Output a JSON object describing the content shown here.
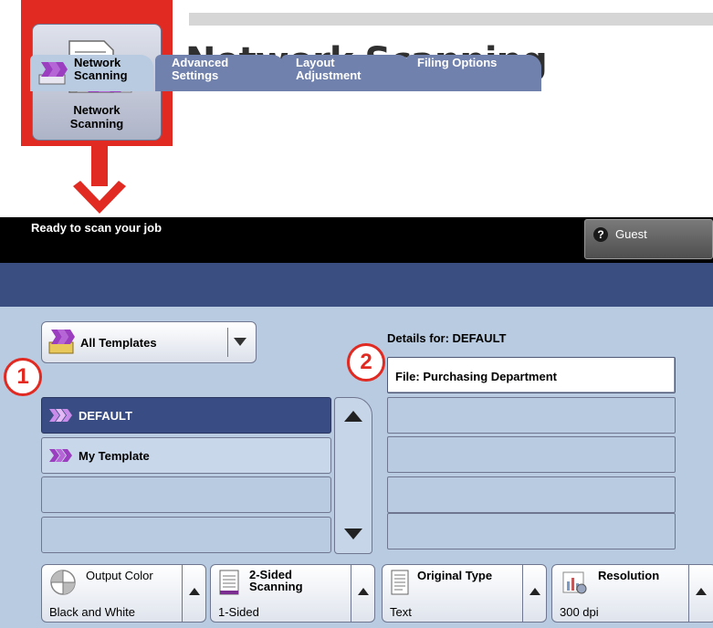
{
  "callout": {
    "label_line1": "Network",
    "label_line2": "Scanning"
  },
  "heading": "Network Scanning",
  "status_bar": {
    "message": "Ready to scan your job",
    "user": "Guest",
    "user_icon_glyph": "?"
  },
  "tabs": [
    {
      "line1": "Network",
      "line2": "Scanning"
    },
    {
      "line1": "Advanced",
      "line2": "Settings"
    },
    {
      "line1": "Layout",
      "line2": "Adjustment"
    },
    {
      "line1": "Filing Options",
      "line2": ""
    }
  ],
  "templates": {
    "filter": "All Templates",
    "items": [
      "DEFAULT",
      "My Template"
    ]
  },
  "details": {
    "title": "Details for: DEFAULT",
    "file": "File: Purchasing Department"
  },
  "badges": [
    "1",
    "2"
  ],
  "features": {
    "output_color": {
      "title": "Output Color",
      "value": "Black and White"
    },
    "two_sided": {
      "title_line1": "2-Sided",
      "title_line2": "Scanning",
      "value": "1-Sided"
    },
    "original_type": {
      "title": "Original Type",
      "value": "Text"
    },
    "resolution": {
      "title": "Resolution",
      "value": "300 dpi"
    }
  },
  "colors": {
    "accent_red": "#e02a22",
    "selected_row": "#3a4c84",
    "tab_strip": "#3b4e82",
    "panel": "#b8cbe1",
    "template_icon": "#9b3fc0"
  }
}
